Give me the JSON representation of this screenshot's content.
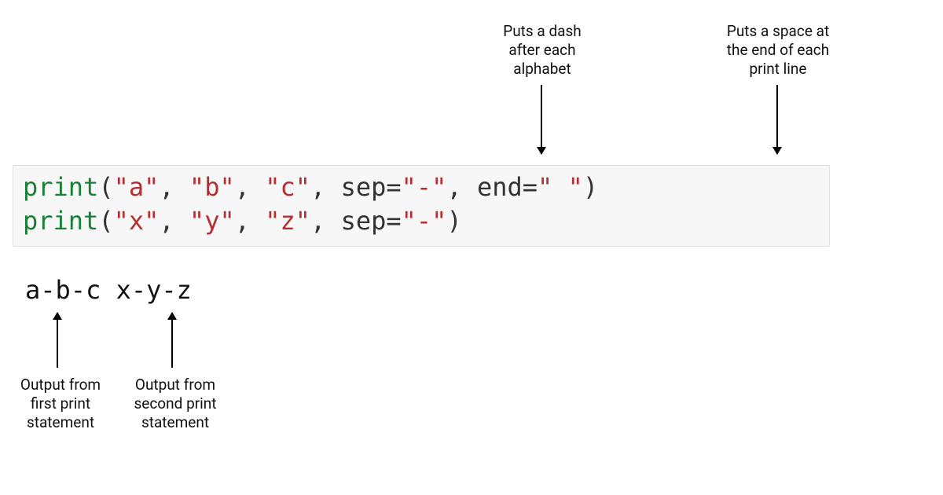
{
  "annotations": {
    "top_sep": "Puts a dash\nafter each\nalphabet",
    "top_end": "Puts a space at\nthe end of each\nprint line",
    "bottom_first": "Output from\nfirst print\nstatement",
    "bottom_second": "Output from\nsecond print\nstatement"
  },
  "code": {
    "line1": {
      "func": "print",
      "open": "(",
      "arg1": "\"a\"",
      "comma1": ", ",
      "arg2": "\"b\"",
      "comma2": ", ",
      "arg3": "\"c\"",
      "comma3": ", ",
      "sep_key": "sep",
      "sep_eq": "=",
      "sep_val": "\"-\"",
      "comma4": ", ",
      "end_key": "end",
      "end_eq": "=",
      "end_val": "\" \"",
      "close": ")"
    },
    "line2": {
      "func": "print",
      "open": "(",
      "arg1": "\"x\"",
      "comma1": ", ",
      "arg2": "\"y\"",
      "comma2": ", ",
      "arg3": "\"z\"",
      "comma3": ", ",
      "sep_key": "sep",
      "sep_eq": "=",
      "sep_val": "\"-\"",
      "close": ")"
    }
  },
  "output": {
    "part1": "a-b-c",
    "space": " ",
    "part2": "x-y-z"
  }
}
